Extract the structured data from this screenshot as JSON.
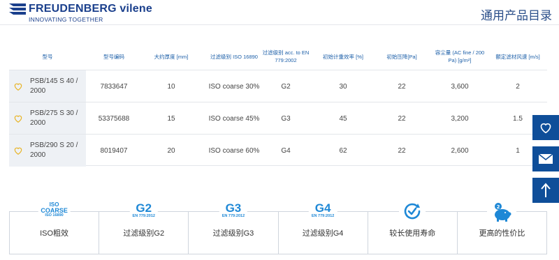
{
  "header": {
    "logo_name": "FREUDENBERG vilene",
    "logo_tagline": "INNOVATING TOGETHER",
    "catalog_title": "通用产品目录"
  },
  "table": {
    "columns": [
      "型号",
      "型号编码",
      "大约厚度 [mm]",
      "过滤级别 ISO 16890",
      "过滤级别 acc. to EN 779:2002",
      "初始计重效率 [%]",
      "初始压降[Pa]",
      "容尘量 (AC fine / 200 Pa) [g/m²]",
      "额定滤材风速 [m/s]"
    ],
    "rows": [
      {
        "model": "PSB/145 S 40 / 2000",
        "code": "7833647",
        "thickness": "10",
        "iso": "ISO coarse 30%",
        "en": "G2",
        "efficiency": "30",
        "pressure": "22",
        "capacity": "3,600",
        "velocity": "2"
      },
      {
        "model": "PSB/275 S 30 / 2000",
        "code": "53375688",
        "thickness": "15",
        "iso": "ISO coarse 45%",
        "en": "G3",
        "efficiency": "45",
        "pressure": "22",
        "capacity": "3,200",
        "velocity": "1.5"
      },
      {
        "model": "PSB/290 S 20 / 2000",
        "code": "8019407",
        "thickness": "20",
        "iso": "ISO coarse 60%",
        "en": "G4",
        "efficiency": "62",
        "pressure": "22",
        "capacity": "2,600",
        "velocity": "1"
      }
    ]
  },
  "features": [
    {
      "badge_top": "ISO",
      "badge_main": "COARSE",
      "badge_sub": "ISO 16890",
      "label": "ISO粗效"
    },
    {
      "badge_main": "G2",
      "badge_sub": "EN 779:2012",
      "label": "过滤级别G2"
    },
    {
      "badge_main": "G3",
      "badge_sub": "EN 779:2012",
      "label": "过滤级别G3"
    },
    {
      "badge_main": "G4",
      "badge_sub": "EN 779:2012",
      "label": "过滤级别G4"
    },
    {
      "icon": "clock-check-icon",
      "label": "较长使用寿命"
    },
    {
      "icon": "piggy-bank-icon",
      "icon_number": "2",
      "label": "更高的性价比"
    }
  ],
  "side_buttons": [
    "heart-icon",
    "mail-icon",
    "arrow-up-icon"
  ],
  "colors": {
    "brand_blue": "#1a3f8c",
    "side_button": "#0f4e99",
    "accent_blue": "#1e88d6",
    "heart_gold": "#e8b323"
  }
}
